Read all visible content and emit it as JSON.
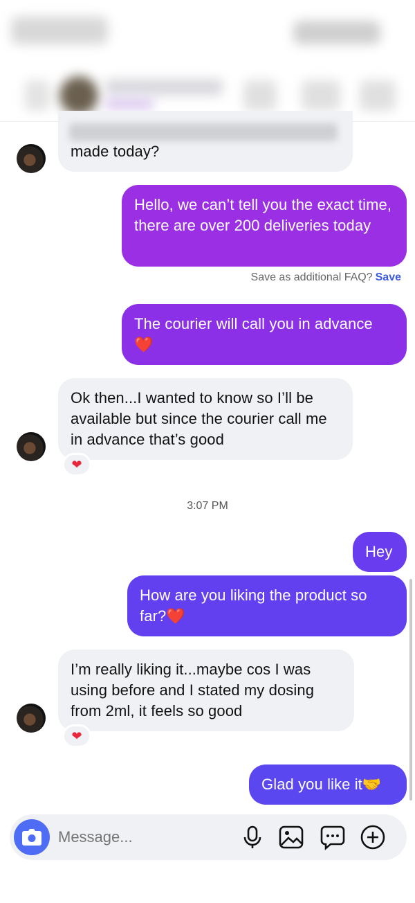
{
  "messages": {
    "m1": "made today?",
    "m2": "Hello, we can’t tell you the exact time, there are over 200 deliveries today",
    "m3": "The courier will call you in advance",
    "m4": "Ok then...I wanted to know so I’ll be available but since the courier call me in advance that’s good",
    "m5": "Hey",
    "m6": "How are you liking the product so far?",
    "m7": "I’m really liking it...maybe cos I was using before and I stated my dosing from 2ml, it feels so good",
    "m8": "Glad you like it"
  },
  "faq": {
    "prompt": "Save as additional FAQ?",
    "action": "Save"
  },
  "timestamp": "3:07 PM",
  "composer": {
    "placeholder": "Message..."
  },
  "icons": [
    "camera-icon",
    "microphone-icon",
    "gallery-icon",
    "chat-bubble-icon",
    "plus-circle-icon",
    "heart-reaction-icon",
    "handshake-emoji"
  ],
  "colors": {
    "incoming": "#f0f1f4",
    "outgoing_top": "#9b2fe3",
    "outgoing_bottom": "#5b47f0",
    "accent": "#3b5bdb"
  }
}
